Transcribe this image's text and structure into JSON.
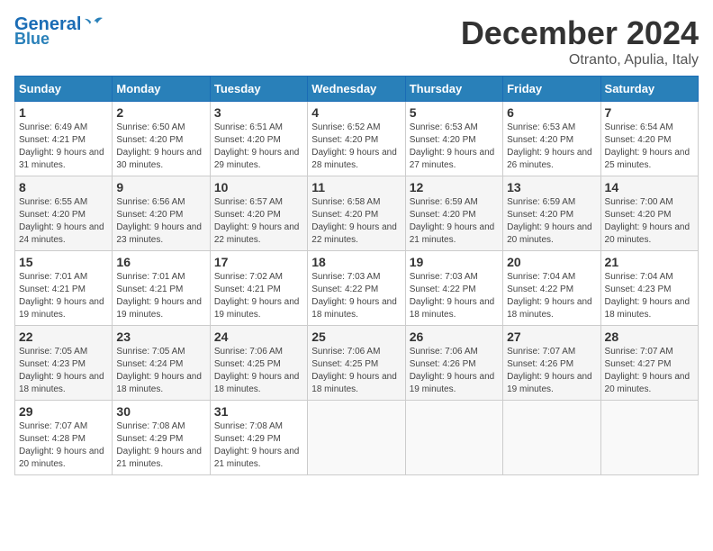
{
  "header": {
    "logo_line1": "General",
    "logo_line2": "Blue",
    "month_title": "December 2024",
    "location": "Otranto, Apulia, Italy"
  },
  "days_of_week": [
    "Sunday",
    "Monday",
    "Tuesday",
    "Wednesday",
    "Thursday",
    "Friday",
    "Saturday"
  ],
  "weeks": [
    [
      {
        "day": "1",
        "sunrise": "6:49 AM",
        "sunset": "4:21 PM",
        "daylight": "9 hours and 31 minutes."
      },
      {
        "day": "2",
        "sunrise": "6:50 AM",
        "sunset": "4:20 PM",
        "daylight": "9 hours and 30 minutes."
      },
      {
        "day": "3",
        "sunrise": "6:51 AM",
        "sunset": "4:20 PM",
        "daylight": "9 hours and 29 minutes."
      },
      {
        "day": "4",
        "sunrise": "6:52 AM",
        "sunset": "4:20 PM",
        "daylight": "9 hours and 28 minutes."
      },
      {
        "day": "5",
        "sunrise": "6:53 AM",
        "sunset": "4:20 PM",
        "daylight": "9 hours and 27 minutes."
      },
      {
        "day": "6",
        "sunrise": "6:53 AM",
        "sunset": "4:20 PM",
        "daylight": "9 hours and 26 minutes."
      },
      {
        "day": "7",
        "sunrise": "6:54 AM",
        "sunset": "4:20 PM",
        "daylight": "9 hours and 25 minutes."
      }
    ],
    [
      {
        "day": "8",
        "sunrise": "6:55 AM",
        "sunset": "4:20 PM",
        "daylight": "9 hours and 24 minutes."
      },
      {
        "day": "9",
        "sunrise": "6:56 AM",
        "sunset": "4:20 PM",
        "daylight": "9 hours and 23 minutes."
      },
      {
        "day": "10",
        "sunrise": "6:57 AM",
        "sunset": "4:20 PM",
        "daylight": "9 hours and 22 minutes."
      },
      {
        "day": "11",
        "sunrise": "6:58 AM",
        "sunset": "4:20 PM",
        "daylight": "9 hours and 22 minutes."
      },
      {
        "day": "12",
        "sunrise": "6:59 AM",
        "sunset": "4:20 PM",
        "daylight": "9 hours and 21 minutes."
      },
      {
        "day": "13",
        "sunrise": "6:59 AM",
        "sunset": "4:20 PM",
        "daylight": "9 hours and 20 minutes."
      },
      {
        "day": "14",
        "sunrise": "7:00 AM",
        "sunset": "4:20 PM",
        "daylight": "9 hours and 20 minutes."
      }
    ],
    [
      {
        "day": "15",
        "sunrise": "7:01 AM",
        "sunset": "4:21 PM",
        "daylight": "9 hours and 19 minutes."
      },
      {
        "day": "16",
        "sunrise": "7:01 AM",
        "sunset": "4:21 PM",
        "daylight": "9 hours and 19 minutes."
      },
      {
        "day": "17",
        "sunrise": "7:02 AM",
        "sunset": "4:21 PM",
        "daylight": "9 hours and 19 minutes."
      },
      {
        "day": "18",
        "sunrise": "7:03 AM",
        "sunset": "4:22 PM",
        "daylight": "9 hours and 18 minutes."
      },
      {
        "day": "19",
        "sunrise": "7:03 AM",
        "sunset": "4:22 PM",
        "daylight": "9 hours and 18 minutes."
      },
      {
        "day": "20",
        "sunrise": "7:04 AM",
        "sunset": "4:22 PM",
        "daylight": "9 hours and 18 minutes."
      },
      {
        "day": "21",
        "sunrise": "7:04 AM",
        "sunset": "4:23 PM",
        "daylight": "9 hours and 18 minutes."
      }
    ],
    [
      {
        "day": "22",
        "sunrise": "7:05 AM",
        "sunset": "4:23 PM",
        "daylight": "9 hours and 18 minutes."
      },
      {
        "day": "23",
        "sunrise": "7:05 AM",
        "sunset": "4:24 PM",
        "daylight": "9 hours and 18 minutes."
      },
      {
        "day": "24",
        "sunrise": "7:06 AM",
        "sunset": "4:25 PM",
        "daylight": "9 hours and 18 minutes."
      },
      {
        "day": "25",
        "sunrise": "7:06 AM",
        "sunset": "4:25 PM",
        "daylight": "9 hours and 18 minutes."
      },
      {
        "day": "26",
        "sunrise": "7:06 AM",
        "sunset": "4:26 PM",
        "daylight": "9 hours and 19 minutes."
      },
      {
        "day": "27",
        "sunrise": "7:07 AM",
        "sunset": "4:26 PM",
        "daylight": "9 hours and 19 minutes."
      },
      {
        "day": "28",
        "sunrise": "7:07 AM",
        "sunset": "4:27 PM",
        "daylight": "9 hours and 20 minutes."
      }
    ],
    [
      {
        "day": "29",
        "sunrise": "7:07 AM",
        "sunset": "4:28 PM",
        "daylight": "9 hours and 20 minutes."
      },
      {
        "day": "30",
        "sunrise": "7:08 AM",
        "sunset": "4:29 PM",
        "daylight": "9 hours and 21 minutes."
      },
      {
        "day": "31",
        "sunrise": "7:08 AM",
        "sunset": "4:29 PM",
        "daylight": "9 hours and 21 minutes."
      },
      null,
      null,
      null,
      null
    ]
  ]
}
